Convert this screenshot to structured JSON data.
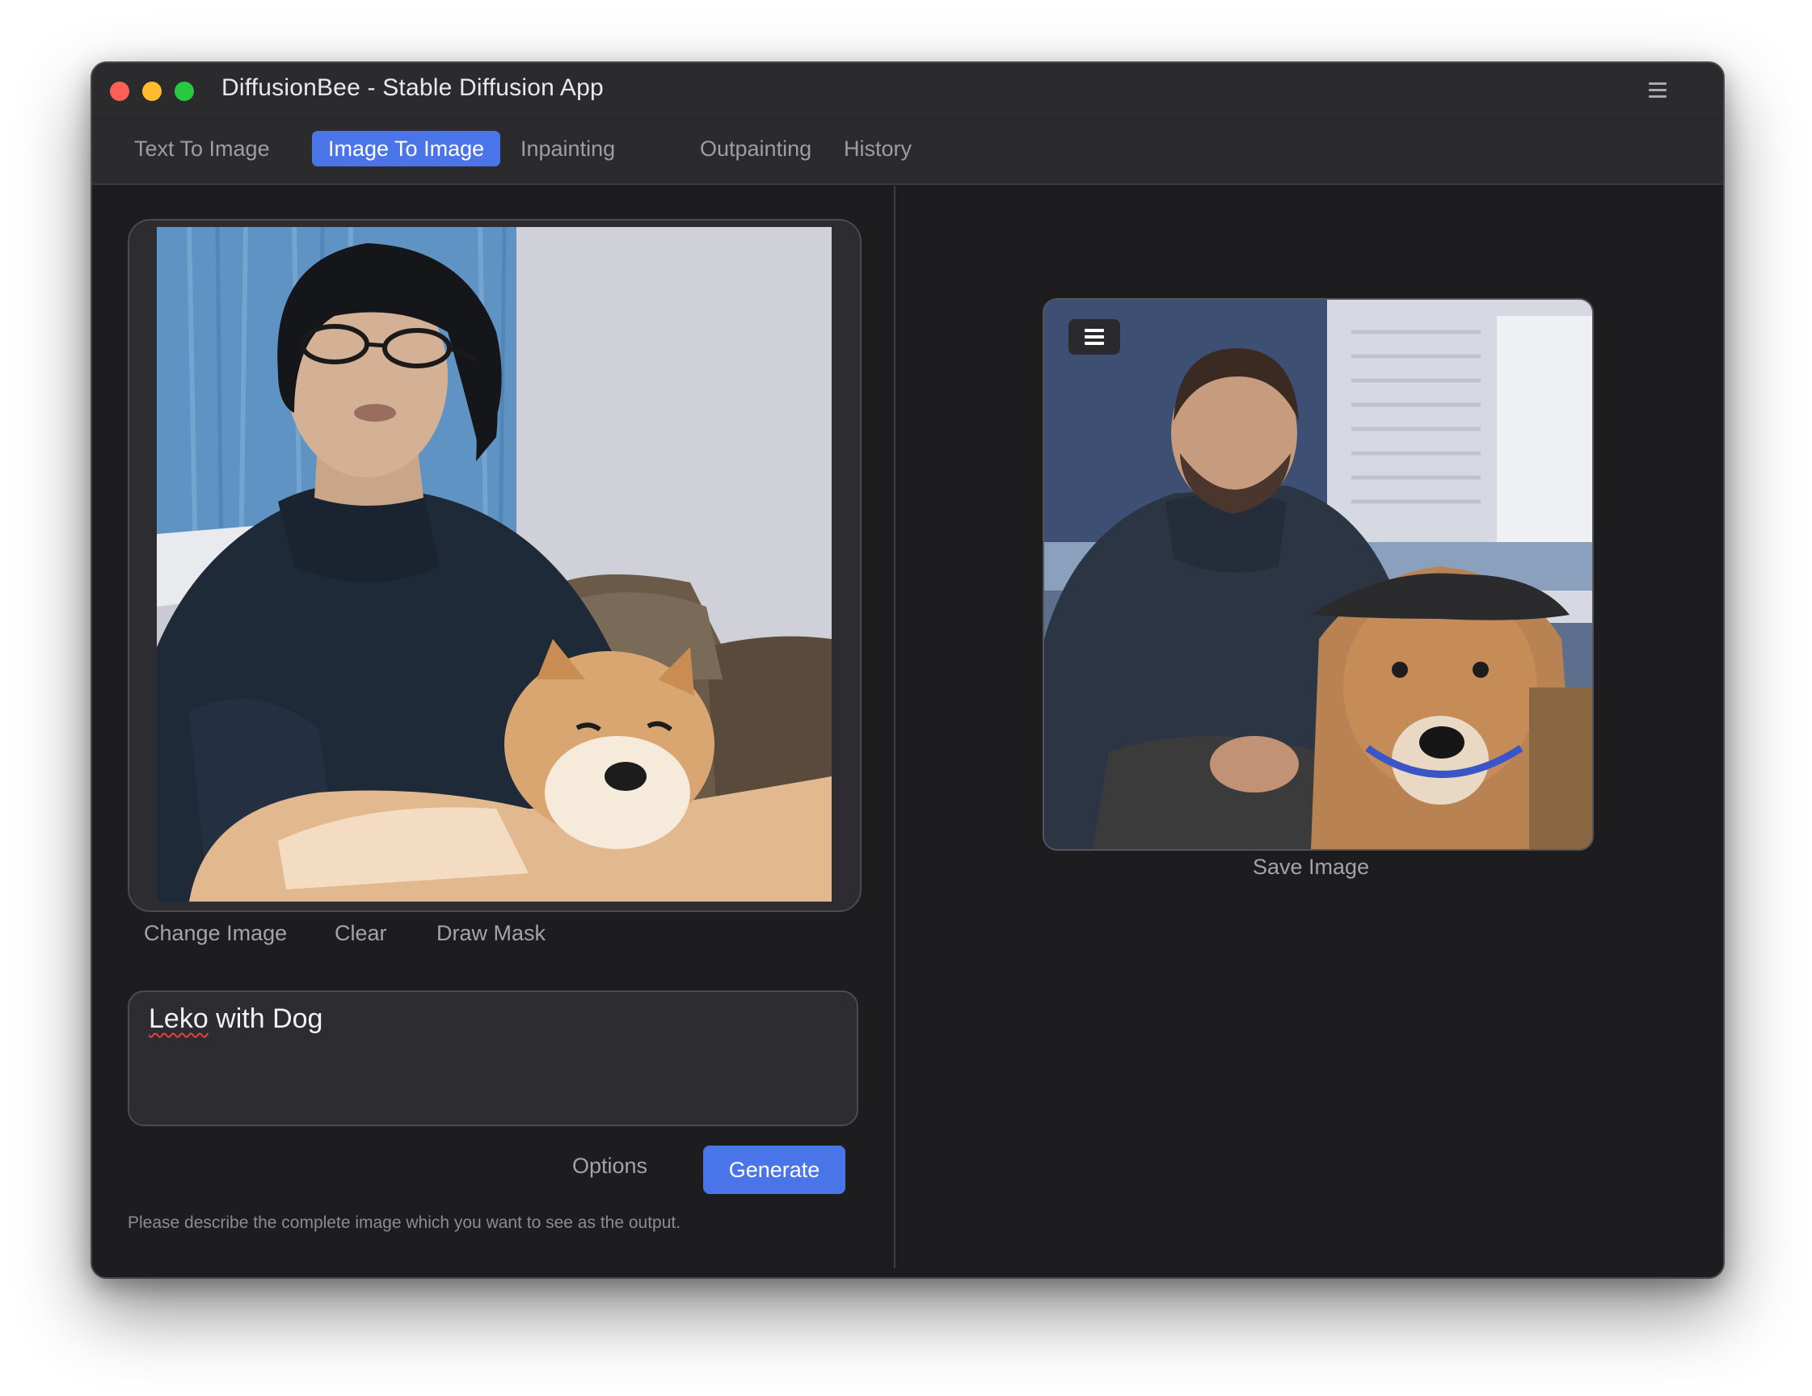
{
  "window": {
    "title": "DiffusionBee - Stable Diffusion App"
  },
  "tabs": [
    {
      "label": "Text To Image",
      "active": false
    },
    {
      "label": "Image To Image",
      "active": true
    },
    {
      "label": "Inpainting",
      "active": false
    },
    {
      "label": "Outpainting",
      "active": false
    },
    {
      "label": "History",
      "active": false
    }
  ],
  "input_panel": {
    "image_description": "input-photo",
    "actions": {
      "change_image": "Change Image",
      "clear": "Clear",
      "draw_mask": "Draw Mask"
    },
    "prompt": {
      "value_word1": "Leko",
      "value_rest": " with Dog"
    },
    "options_label": "Options",
    "generate_label": "Generate",
    "hint": "Please describe the complete image which you want to see as the output."
  },
  "output_panel": {
    "image_description": "generated-photo",
    "save_label": "Save Image"
  },
  "colors": {
    "accent": "#4a75e8",
    "window_bg": "#1d1d1f",
    "titlebar_bg": "#2b2a2d"
  },
  "icons": {
    "window_menu": "hamburger-menu-icon",
    "output_menu": "hamburger-menu-icon"
  }
}
